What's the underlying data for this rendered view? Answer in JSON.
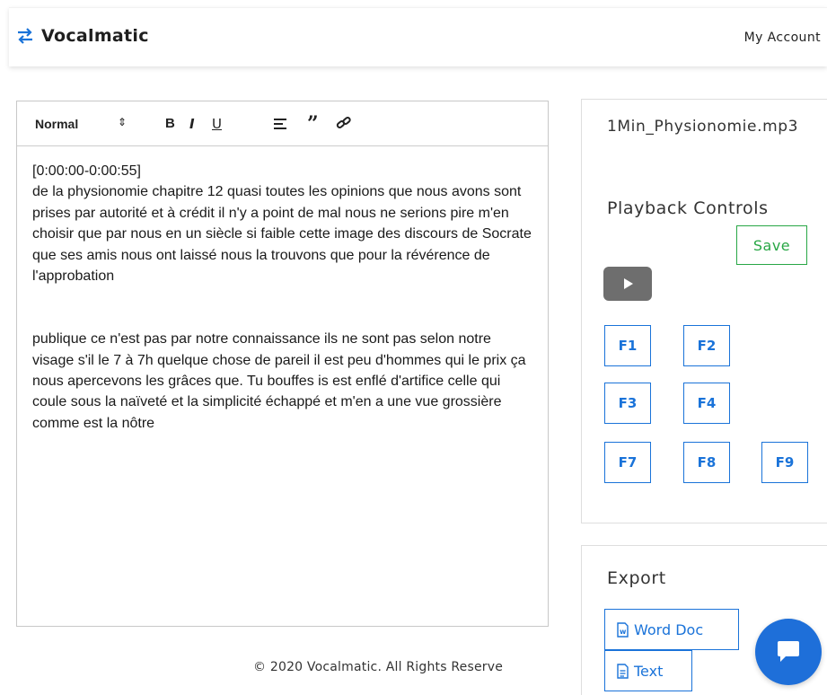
{
  "app": {
    "name": "Vocalmatic",
    "account_label": "My Account"
  },
  "editor": {
    "toolbar": {
      "header_select": "Normal",
      "bold": "B",
      "italic": "I",
      "underline": "U",
      "quote": "”"
    },
    "paragraphs": [
      "[0:00:00-0:00:55]",
      "de la physionomie chapitre 12 quasi toutes les opinions que nous avons sont prises par autorité et à crédit il n'y a point de mal nous ne serions pire m'en choisir que par nous en un siècle si faible cette image des discours de Socrate que ses amis nous ont laissé nous la trouvons que pour la révérence de l'approbation",
      "publique ce n'est pas par notre connaissance ils ne sont pas selon notre visage s'il le 7 à 7h quelque chose de pareil il est peu d'hommes qui le prix ça nous apercevons les grâces que. Tu bouffes is est enflé d'artifice celle qui coule sous la naïveté et la simplicité échappé et m'en a une vue grossière comme est la nôtre"
    ]
  },
  "player": {
    "file_name": "1Min_Physionomie.mp3",
    "title": "Playback Controls",
    "save_label": "Save",
    "function_keys": [
      "F1",
      "F2",
      "F3",
      "F4",
      "F7",
      "F8",
      "F9"
    ]
  },
  "export": {
    "title": "Export",
    "word_label": "Word Doc",
    "text_label": "Text"
  },
  "footer": {
    "text": "© 2020 Vocalmatic. All Rights Reserve"
  },
  "colors": {
    "accent": "#1a73d9",
    "success": "#28a745",
    "play_button": "#6e6e6e",
    "chat": "#1e6fd9"
  }
}
